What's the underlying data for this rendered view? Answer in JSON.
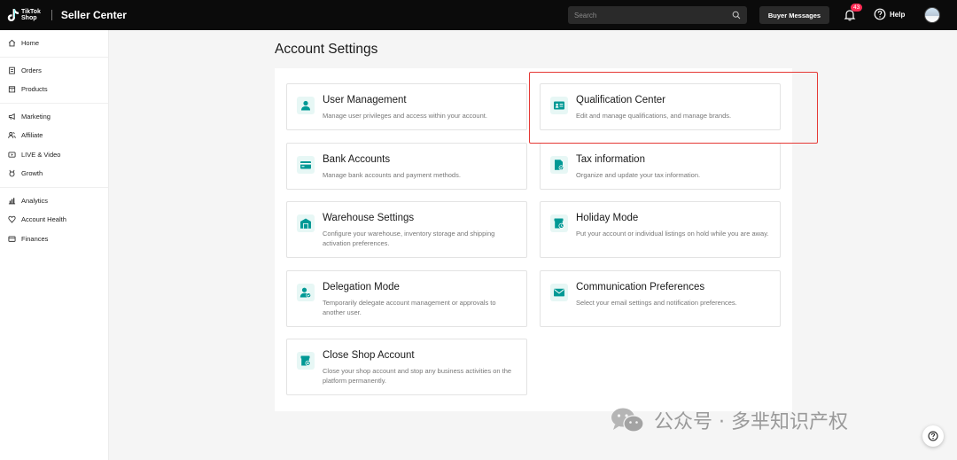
{
  "header": {
    "logo_line1": "TikTok",
    "logo_line2": "Shop",
    "app_title": "Seller Center",
    "search_placeholder": "Search",
    "buyer_messages": "Buyer Messages",
    "notification_count": "43",
    "help_label": "Help"
  },
  "sidebar": {
    "groups": [
      [
        {
          "label": "Home",
          "icon": "home-icon"
        }
      ],
      [
        {
          "label": "Orders",
          "icon": "orders-icon"
        },
        {
          "label": "Products",
          "icon": "products-icon"
        }
      ],
      [
        {
          "label": "Marketing",
          "icon": "megaphone-icon"
        },
        {
          "label": "Affiliate",
          "icon": "affiliate-icon"
        },
        {
          "label": "LIVE & Video",
          "icon": "video-icon"
        },
        {
          "label": "Growth",
          "icon": "medal-icon"
        }
      ],
      [
        {
          "label": "Analytics",
          "icon": "chart-icon"
        },
        {
          "label": "Account Health",
          "icon": "health-icon"
        },
        {
          "label": "Finances",
          "icon": "wallet-icon"
        }
      ]
    ]
  },
  "page": {
    "title": "Account Settings"
  },
  "cards": {
    "user_management": {
      "title": "User Management",
      "desc": "Manage user privileges and access within your account.",
      "icon": "user-icon"
    },
    "qualification_center": {
      "title": "Qualification Center",
      "desc": "Edit and manage qualifications, and manage brands.",
      "icon": "id-card-icon"
    },
    "bank_accounts": {
      "title": "Bank Accounts",
      "desc": "Manage bank accounts and payment methods.",
      "icon": "bank-card-icon"
    },
    "tax_information": {
      "title": "Tax information",
      "desc": "Organize and update your tax information.",
      "icon": "tax-doc-icon"
    },
    "warehouse_settings": {
      "title": "Warehouse Settings",
      "desc": "Configure your warehouse, inventory storage and shipping activation preferences.",
      "icon": "warehouse-icon"
    },
    "holiday_mode": {
      "title": "Holiday Mode",
      "desc": "Put your account or individual listings on hold while you are away.",
      "icon": "store-clock-icon"
    },
    "delegation_mode": {
      "title": "Delegation Mode",
      "desc": "Temporarily delegate account management or approvals to another user.",
      "icon": "user-check-icon"
    },
    "communication_preferences": {
      "title": "Communication Preferences",
      "desc": "Select your email settings and notification preferences.",
      "icon": "mail-icon"
    },
    "close_shop_account": {
      "title": "Close Shop Account",
      "desc": "Close your shop account and stop any business activities on the platform permanently.",
      "icon": "store-close-icon"
    }
  },
  "watermark": {
    "text": "公众号 · 多芈知识产权"
  },
  "colors": {
    "accent": "#009995",
    "icon_bg": "#e7f7f5",
    "highlight": "#e53935",
    "topbar": "#0b0b0b"
  }
}
